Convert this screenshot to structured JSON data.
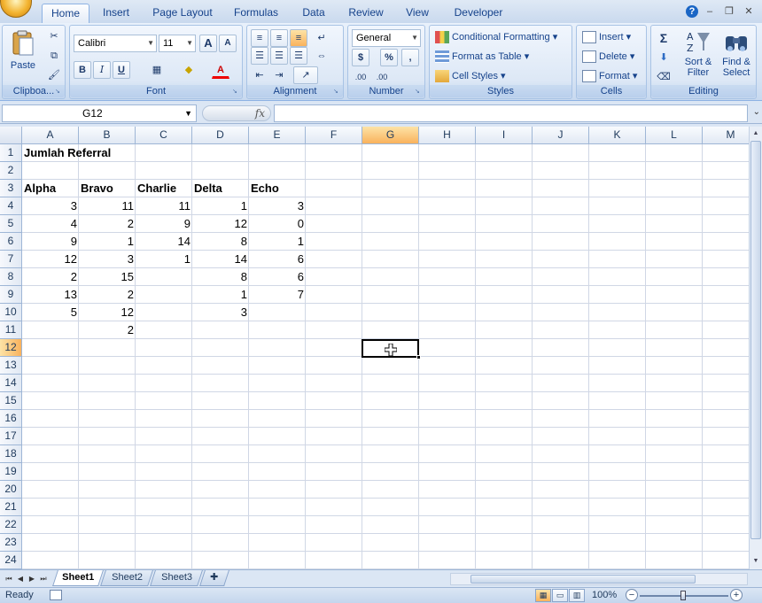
{
  "ribbon": {
    "tabs": [
      "Home",
      "Insert",
      "Page Layout",
      "Formulas",
      "Data",
      "Review",
      "View",
      "Developer"
    ],
    "active_tab": "Home",
    "clipboard": {
      "paste": "Paste",
      "label": "Clipboa..."
    },
    "font": {
      "name": "Calibri",
      "size": "11",
      "label": "Font",
      "bold": "B",
      "italic": "I",
      "underline": "U",
      "grow": "A",
      "shrink": "A",
      "font_color": "A"
    },
    "alignment": {
      "label": "Alignment"
    },
    "number": {
      "format": "General",
      "currency": "$",
      "percent": "%",
      "comma": ",",
      "inc_dec": ".00",
      "dec_dec": ".00",
      "label": "Number"
    },
    "styles": {
      "conditional": "Conditional Formatting",
      "format_table": "Format as Table",
      "cell_styles": "Cell Styles",
      "label": "Styles"
    },
    "cells": {
      "insert": "Insert",
      "delete": "Delete",
      "format": "Format",
      "label": "Cells"
    },
    "editing": {
      "sum": "Σ",
      "sort_filter_1": "Sort &",
      "sort_filter_2": "Filter",
      "find_1": "Find &",
      "find_2": "Select",
      "label": "Editing"
    }
  },
  "formula_bar": {
    "name_box": "G12",
    "fx": "fx",
    "value": ""
  },
  "grid": {
    "columns": [
      "A",
      "B",
      "C",
      "D",
      "E",
      "F",
      "G",
      "H",
      "I",
      "J",
      "K",
      "L",
      "M"
    ],
    "selected_column": "G",
    "rows": [
      "1",
      "2",
      "3",
      "4",
      "5",
      "6",
      "7",
      "8",
      "9",
      "10",
      "11",
      "12",
      "13",
      "14",
      "15",
      "16",
      "17",
      "18",
      "19",
      "20",
      "21",
      "22",
      "23",
      "24"
    ],
    "selected_row": "12",
    "title": "Jumlah Referral",
    "headers": [
      "Alpha",
      "Bravo",
      "Charlie",
      "Delta",
      "Echo"
    ],
    "data": [
      [
        "3",
        "11",
        "11",
        "1",
        "3"
      ],
      [
        "4",
        "2",
        "9",
        "12",
        "0"
      ],
      [
        "9",
        "1",
        "14",
        "8",
        "1"
      ],
      [
        "12",
        "3",
        "1",
        "14",
        "6"
      ],
      [
        "2",
        "15",
        "",
        "8",
        "6"
      ],
      [
        "13",
        "2",
        "",
        "1",
        "7"
      ],
      [
        "5",
        "12",
        "",
        "3",
        ""
      ],
      [
        "",
        "2",
        "",
        "",
        ""
      ]
    ]
  },
  "sheets": {
    "tabs": [
      "Sheet1",
      "Sheet2",
      "Sheet3"
    ],
    "active": "Sheet1"
  },
  "status": {
    "text": "Ready",
    "zoom": "100%"
  },
  "colors": {
    "accent": "#15428b",
    "selected_header": "#f9b25c",
    "grid_line": "#d0d7e5"
  }
}
